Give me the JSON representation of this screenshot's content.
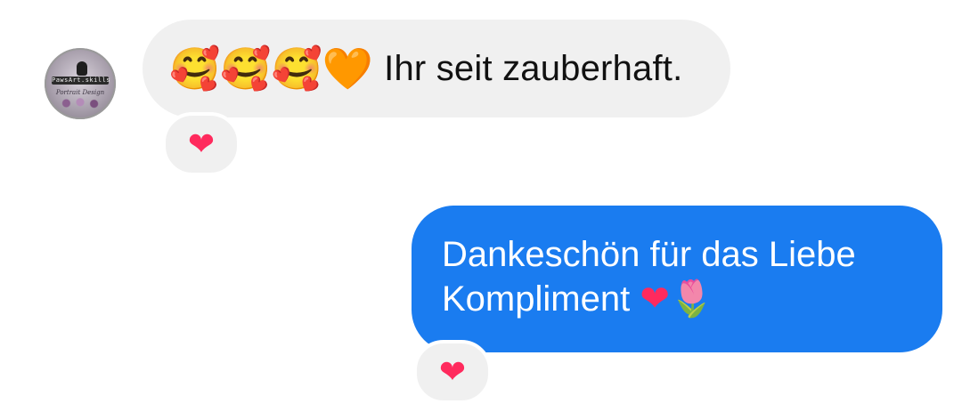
{
  "thread": {
    "incoming": {
      "avatar": {
        "band_text": "PawsArt.skills",
        "script_text": "Portrait Design"
      },
      "emojis": [
        "🥰",
        "🥰",
        "🥰",
        "🧡"
      ],
      "text": "Ihr seit zauberhaft.",
      "reaction": "❤"
    },
    "outgoing": {
      "line1": "Dankeschön für das Liebe",
      "line2_text": "Kompliment ",
      "line2_emojis": [
        "❤",
        "🌷"
      ],
      "reaction": "❤"
    }
  },
  "colors": {
    "incoming_bubble": "#f0f0f0",
    "outgoing_bubble": "#1a7cf0",
    "reaction_heart": "#ff2a5d"
  }
}
